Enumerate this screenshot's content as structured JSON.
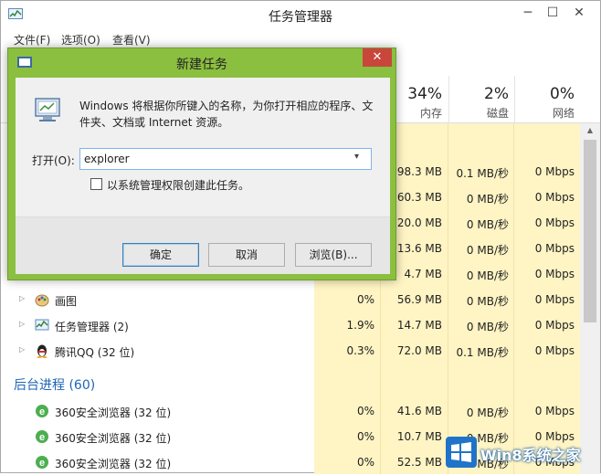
{
  "taskmanager": {
    "title": "任务管理器",
    "window_buttons": {
      "minimize": "─",
      "maximize": "☐",
      "close": "✕"
    },
    "menu": [
      "文件(F)",
      "选项(O)",
      "查看(V)"
    ],
    "columns": [
      {
        "pct": "34%",
        "name": "内存"
      },
      {
        "pct": "2%",
        "name": "磁盘"
      },
      {
        "pct": "0%",
        "name": "网络"
      }
    ],
    "hidden_rows": [
      {
        "mem": "98.3 MB",
        "disk": "0.1 MB/秒",
        "net": "0 Mbps"
      },
      {
        "mem": "60.3 MB",
        "disk": "0 MB/秒",
        "net": "0 Mbps"
      },
      {
        "mem": "20.0 MB",
        "disk": "0 MB/秒",
        "net": "0 Mbps"
      },
      {
        "mem": "13.6 MB",
        "disk": "0 MB/秒",
        "net": "0 Mbps"
      },
      {
        "mem": "4.7 MB",
        "disk": "0 MB/秒",
        "net": "0 Mbps"
      }
    ],
    "app_rows": [
      {
        "name": "画图",
        "cpu": "0%",
        "mem": "56.9 MB",
        "disk": "0 MB/秒",
        "net": "0 Mbps"
      },
      {
        "name": "任务管理器 (2)",
        "cpu": "1.9%",
        "mem": "14.7 MB",
        "disk": "0 MB/秒",
        "net": "0 Mbps"
      },
      {
        "name": "腾讯QQ (32 位)",
        "cpu": "0.3%",
        "mem": "72.0 MB",
        "disk": "0.1 MB/秒",
        "net": "0 Mbps"
      }
    ],
    "background_section": "后台进程 (60)",
    "bg_rows": [
      {
        "name": "360安全浏览器 (32 位)",
        "cpu": "0%",
        "mem": "41.6 MB",
        "disk": "0 MB/秒",
        "net": "0 Mbps"
      },
      {
        "name": "360安全浏览器 (32 位)",
        "cpu": "0%",
        "mem": "10.7 MB",
        "disk": "0 MB/秒",
        "net": "0 Mbps"
      },
      {
        "name": "360安全浏览器 (32 位)",
        "cpu": "0%",
        "mem": "52.5 MB",
        "disk": "0 MB/秒",
        "net": "0 Mbps"
      }
    ]
  },
  "run_dialog": {
    "title": "新建任务",
    "close": "✕",
    "description": "Windows 将根据你所键入的名称，为你打开相应的程序、文件夹、文档或 Internet 资源。",
    "open_label": "打开(O):",
    "open_value": "explorer",
    "combo_arrow": "▾",
    "admin_checkbox_label": "以系统管理权限创建此任务。",
    "admin_checked": false,
    "buttons": {
      "ok": "确定",
      "cancel": "取消",
      "browse": "浏览(B)..."
    }
  },
  "watermark": {
    "text": "Win8系统之家"
  },
  "colors": {
    "accent_green": "#8bbf40",
    "close_red": "#c9463d",
    "section_blue": "#1e64b4",
    "shade_yellow": "#fff4c4"
  }
}
